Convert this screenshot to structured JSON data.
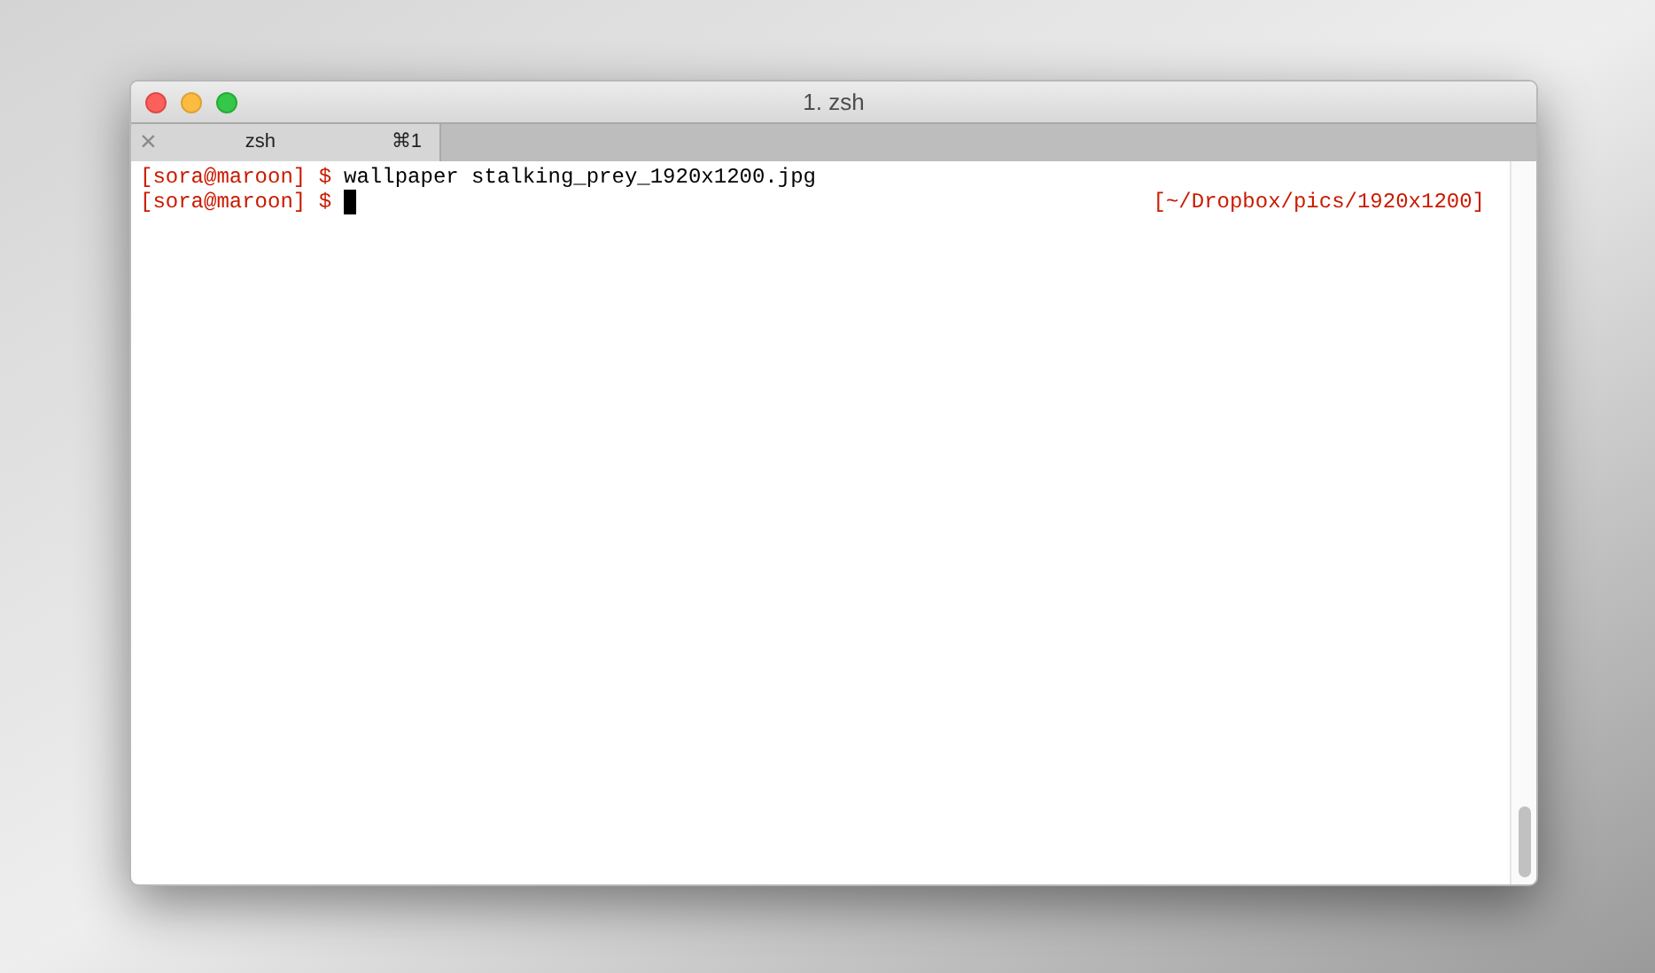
{
  "window": {
    "title": "1. zsh"
  },
  "tabs": [
    {
      "label": "zsh",
      "shortcut": "⌘1",
      "close": "×",
      "selected": true
    }
  ],
  "lines": [
    {
      "prompt": "[sora@maroon] $",
      "command": "wallpaper stalking_prey_1920x1200.jpg",
      "cursor": false
    },
    {
      "prompt": "[sora@maroon] $",
      "right_prompt": "[~/Dropbox/pics/1920x1200]",
      "cursor": true
    }
  ]
}
